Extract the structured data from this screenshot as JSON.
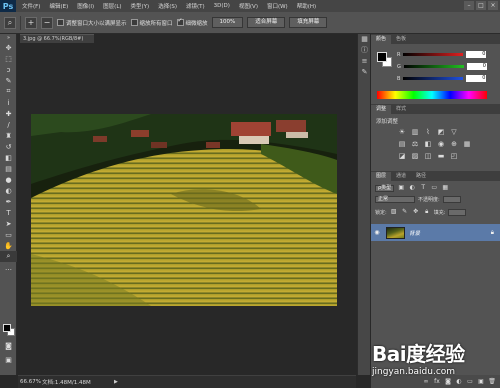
{
  "app": {
    "logo": "Ps"
  },
  "menu": [
    "文件(F)",
    "编辑(E)",
    "图像(I)",
    "图层(L)",
    "类型(Y)",
    "选择(S)",
    "滤镜(T)",
    "3D(D)",
    "视图(V)",
    "窗口(W)",
    "帮助(H)"
  ],
  "window_controls": [
    "–",
    "□",
    "×"
  ],
  "options": {
    "resize_windows_label": "调整窗口大小以满屏显示",
    "resize_windows_checked": false,
    "zoom_all_label": "缩放所有窗口",
    "zoom_all_checked": false,
    "scrubby_zoom_label": "细微缩放",
    "scrubby_zoom_checked": true,
    "btn_100": "100%",
    "btn_fit": "适合屏幕",
    "btn_fill": "填充屏幕"
  },
  "document": {
    "tab_title": "3.jpg @ 66.7%(RGB/8#)",
    "zoom_status": "66.67%",
    "doc_status": "文档:1.48M/1.48M"
  },
  "color_panel": {
    "tabs": [
      "颜色",
      "色板"
    ],
    "rows": [
      {
        "label": "R",
        "value": "0",
        "color": "#e02020"
      },
      {
        "label": "G",
        "value": "0",
        "color": "#20c020"
      },
      {
        "label": "B",
        "value": "0",
        "color": "#2050e0"
      }
    ]
  },
  "adjustments_panel": {
    "tabs": [
      "调整",
      "样式"
    ],
    "title": "添加调整"
  },
  "layers_panel": {
    "tabs": [
      "图层",
      "通道",
      "路径"
    ],
    "kind_filter": "ρ类型",
    "blend_mode": "正常",
    "opacity_label": "不透明度:",
    "lock_label": "锁定:",
    "fill_label": "填充:",
    "layer_name": "背景"
  },
  "watermark": {
    "main": "Bai度经验",
    "sub": "jingyan.baidu.com"
  },
  "icons": {
    "tools": [
      "move-icon",
      "marquee-icon",
      "lasso-icon",
      "quick-select-icon",
      "crop-icon",
      "eyedropper-icon",
      "healing-icon",
      "brush-icon",
      "clone-stamp-icon",
      "history-brush-icon",
      "eraser-icon",
      "gradient-icon",
      "blur-icon",
      "dodge-icon",
      "pen-icon",
      "type-icon",
      "path-select-icon",
      "rectangle-icon",
      "hand-icon",
      "zoom-icon"
    ]
  }
}
